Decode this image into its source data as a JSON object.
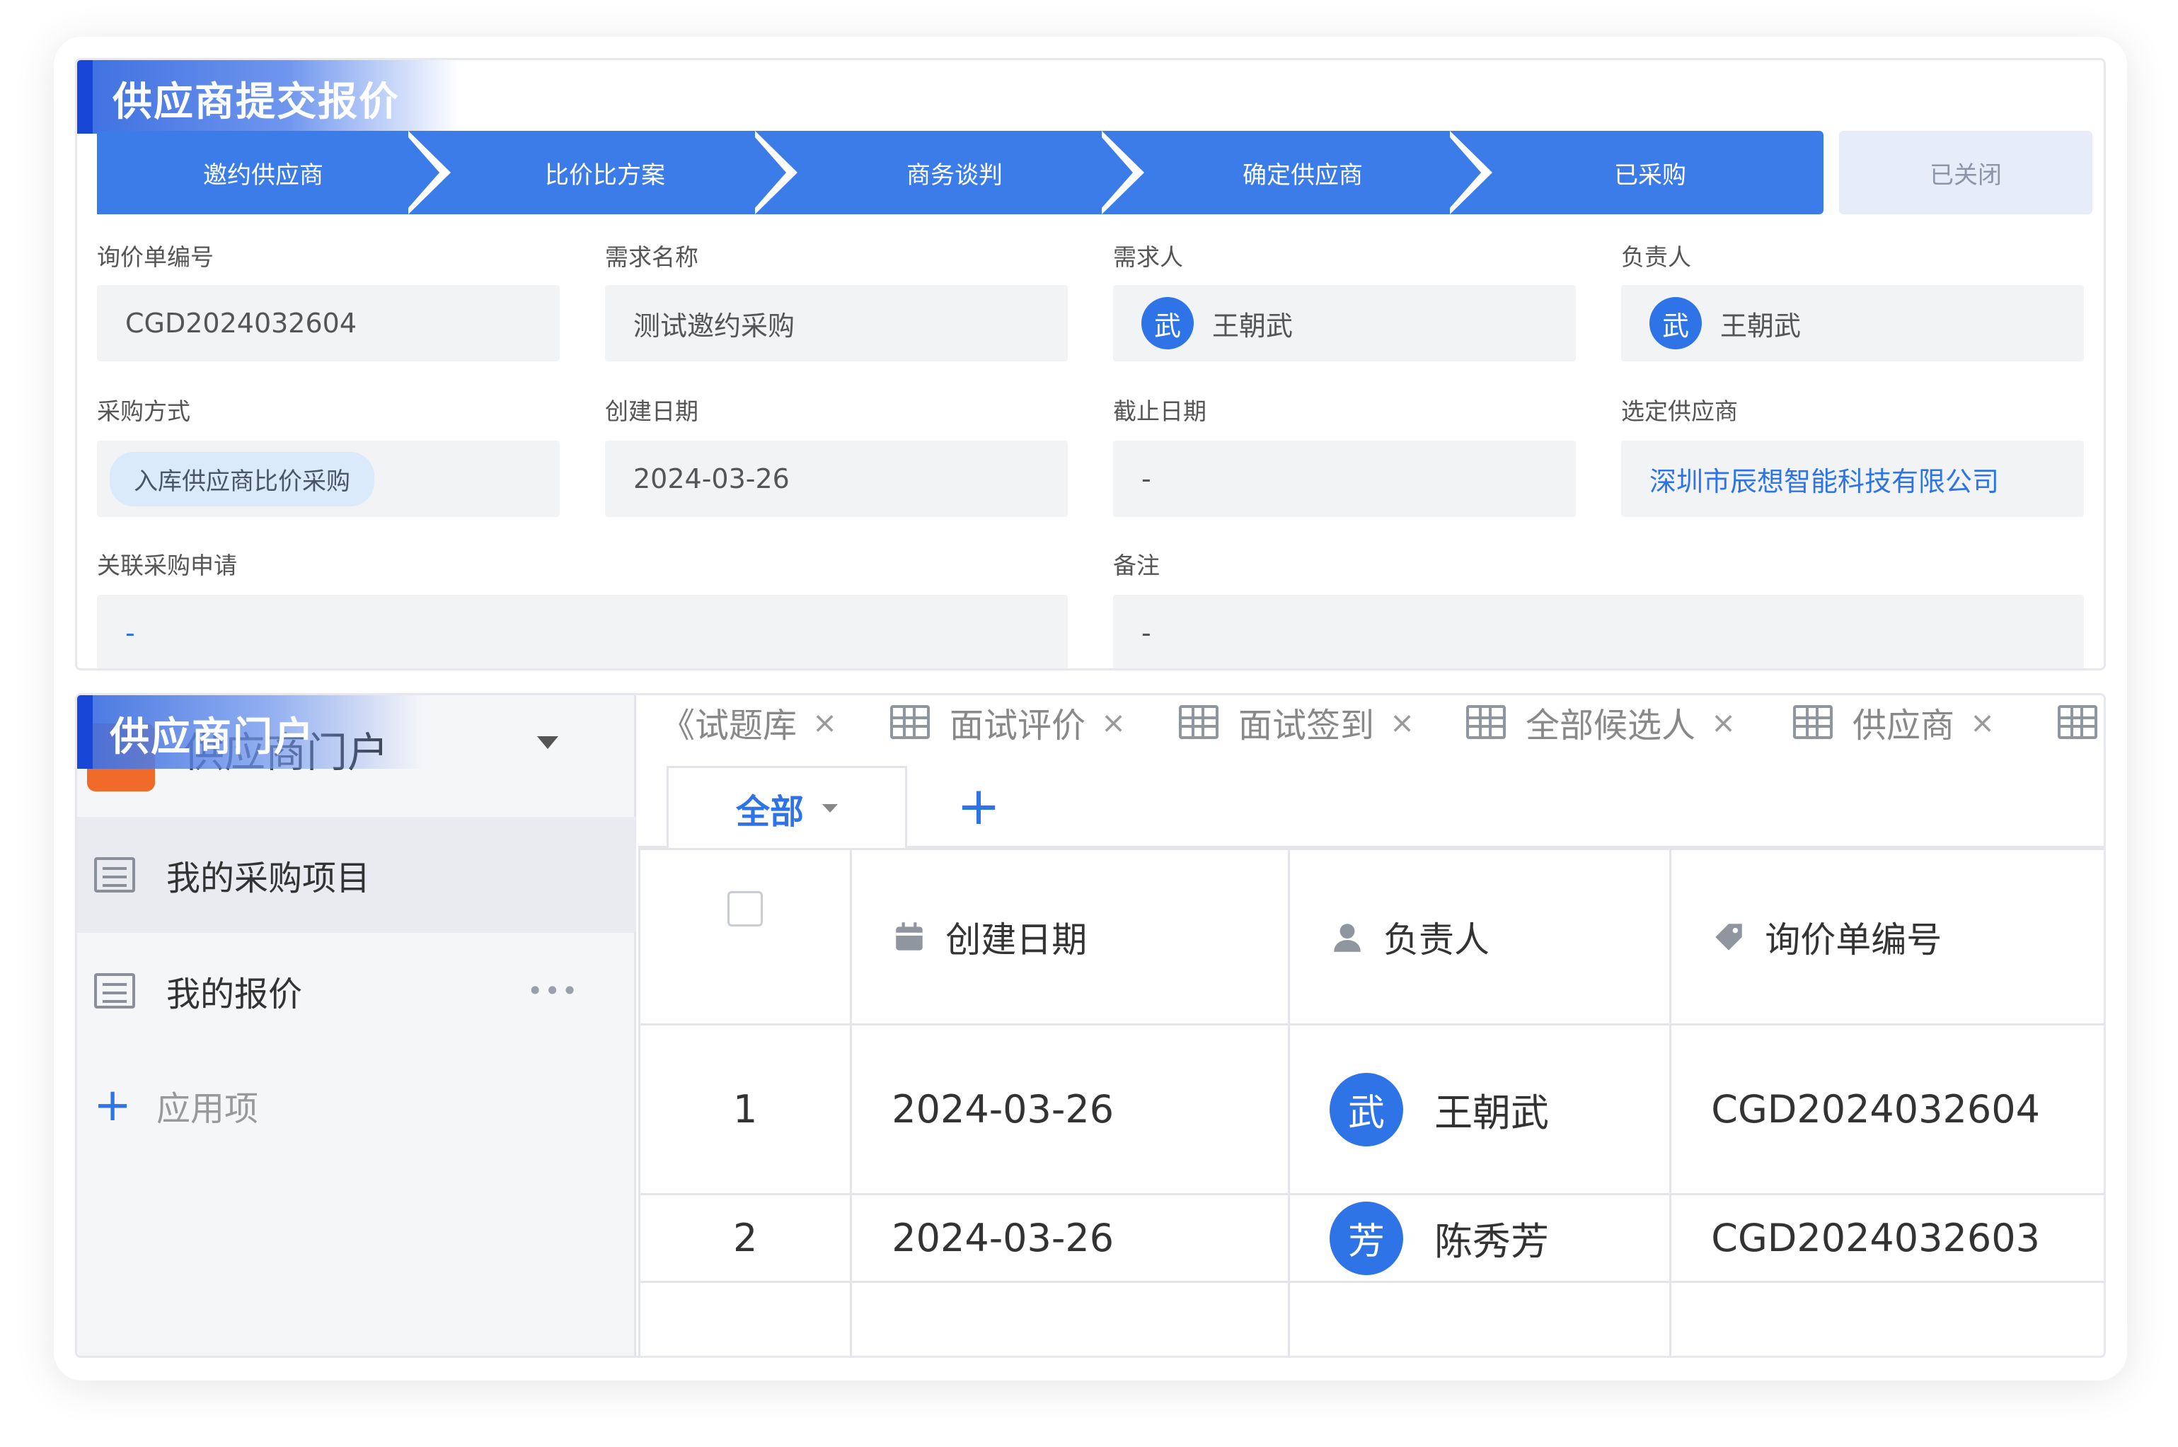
{
  "top_section": {
    "tag": "供应商提交报价",
    "steps": [
      "邀约供应商",
      "比价比方案",
      "商务谈判",
      "确定供应商",
      "已采购"
    ],
    "closed_step": "已关闭",
    "fields": {
      "inquiry_no": {
        "label": "询价单编号",
        "value": "CGD2024032604"
      },
      "demand_name": {
        "label": "需求名称",
        "value": "测试邀约采购"
      },
      "requester": {
        "label": "需求人",
        "avatar": "武",
        "value": "王朝武"
      },
      "owner": {
        "label": "负责人",
        "avatar": "武",
        "value": "王朝武"
      },
      "method": {
        "label": "采购方式",
        "value": "入库供应商比价采购"
      },
      "created": {
        "label": "创建日期",
        "value": "2024-03-26"
      },
      "deadline": {
        "label": "截止日期",
        "value": "-"
      },
      "supplier": {
        "label": "选定供应商",
        "value": "深圳市辰想智能科技有限公司"
      },
      "related": {
        "label": "关联采购申请",
        "value": "-"
      },
      "remark": {
        "label": "备注",
        "value": "-"
      }
    }
  },
  "bottom_section": {
    "tag": "供应商门户",
    "portal_name": "供应商门户",
    "nav": [
      {
        "label": "我的采购项目"
      },
      {
        "label": "我的报价",
        "more": "•••"
      }
    ],
    "add_app": {
      "plus": "+",
      "label": "应用项"
    },
    "tabs": [
      {
        "label": "《试题库",
        "close": "×"
      },
      {
        "label": "面试评价",
        "close": "×"
      },
      {
        "label": "面试签到",
        "close": "×"
      },
      {
        "label": "全部候选人",
        "close": "×"
      },
      {
        "label": "供应商",
        "close": "×"
      }
    ],
    "view": {
      "label": "全部",
      "add": "+"
    },
    "table": {
      "headers": {
        "created": "创建日期",
        "owner": "负责人",
        "inquiry_no": "询价单编号"
      },
      "rows": [
        {
          "index": "1",
          "created": "2024-03-26",
          "avatar": "武",
          "owner": "王朝武",
          "inquiry_no": "CGD2024032604"
        },
        {
          "index": "2",
          "created": "2024-03-26",
          "avatar": "芳",
          "owner": "陈秀芳",
          "inquiry_no": "CGD2024032603"
        }
      ]
    }
  }
}
